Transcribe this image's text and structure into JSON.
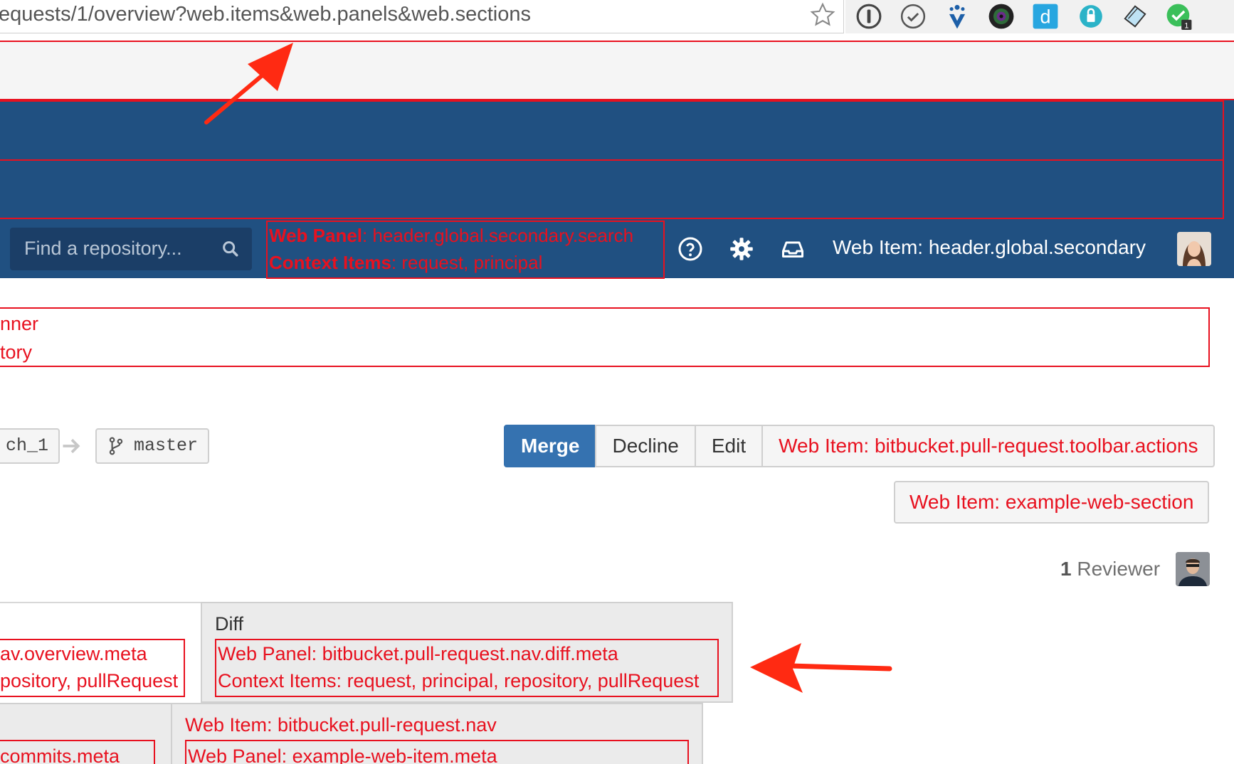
{
  "browser": {
    "url": "equests/1/overview?web.items&web.panels&web.sections"
  },
  "header": {
    "search_placeholder": "Find a repository...",
    "search_panel": {
      "line1_key": "Web Panel",
      "line1_value": ": header.global.secondary.search",
      "line2_key": "Context Items",
      "line2_value": ": request, principal"
    },
    "secondary_item": "Web Item: header.global.secondary"
  },
  "banner": {
    "line1": "nner",
    "line2": "tory"
  },
  "branches": {
    "source": "ch_1",
    "target": "master"
  },
  "toolbar": {
    "merge": "Merge",
    "decline": "Decline",
    "edit": "Edit",
    "actions_item": "Web Item: bitbucket.pull-request.toolbar.actions",
    "web_section_item": "Web Item: example-web-section"
  },
  "reviewers": {
    "count": "1",
    "label": " Reviewer"
  },
  "tabs": {
    "overview": {
      "line1": "av.overview.meta",
      "line2": "pository, pullRequest"
    },
    "diff": {
      "title": "Diff",
      "line1": "Web Panel: bitbucket.pull-request.nav.diff.meta",
      "line2": "Context Items: request, principal, repository, pullRequest"
    },
    "commits": {
      "line1": "commits.meta"
    },
    "example": {
      "title": "Web Item: bitbucket.pull-request.nav",
      "line1": "Web Panel: example-web-item.meta"
    }
  },
  "colors": {
    "header_blue": "#205081",
    "annotation_red": "#e8111f",
    "merge_blue": "#3572b0"
  }
}
